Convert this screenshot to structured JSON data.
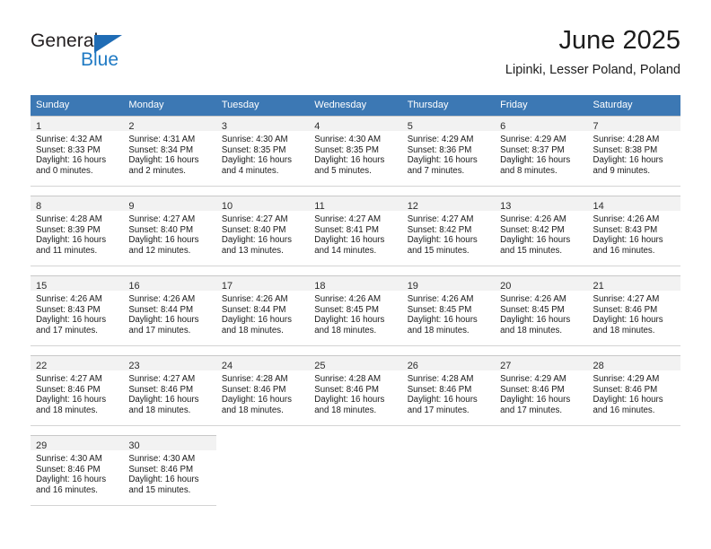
{
  "brand": {
    "name_top": "General",
    "name_bottom": "Blue",
    "triangle_color": "#1f6cb5",
    "text_color": "#231f20",
    "blue_color": "#1f7ac4"
  },
  "header": {
    "title": "June 2025",
    "subtitle": "Lipinki, Lesser Poland, Poland"
  },
  "colors": {
    "header_row_bg": "#3c78b4",
    "header_row_text": "#ffffff",
    "daynum_strip_bg": "#f2f2f2",
    "cell_border": "#d4d4d4",
    "body_text": "#1a1a1a"
  },
  "weekday_headers": [
    "Sunday",
    "Monday",
    "Tuesday",
    "Wednesday",
    "Thursday",
    "Friday",
    "Saturday"
  ],
  "weeks": [
    [
      {
        "day": "1",
        "sunrise": "Sunrise: 4:32 AM",
        "sunset": "Sunset: 8:33 PM",
        "daylight1": "Daylight: 16 hours",
        "daylight2": "and 0 minutes."
      },
      {
        "day": "2",
        "sunrise": "Sunrise: 4:31 AM",
        "sunset": "Sunset: 8:34 PM",
        "daylight1": "Daylight: 16 hours",
        "daylight2": "and 2 minutes."
      },
      {
        "day": "3",
        "sunrise": "Sunrise: 4:30 AM",
        "sunset": "Sunset: 8:35 PM",
        "daylight1": "Daylight: 16 hours",
        "daylight2": "and 4 minutes."
      },
      {
        "day": "4",
        "sunrise": "Sunrise: 4:30 AM",
        "sunset": "Sunset: 8:35 PM",
        "daylight1": "Daylight: 16 hours",
        "daylight2": "and 5 minutes."
      },
      {
        "day": "5",
        "sunrise": "Sunrise: 4:29 AM",
        "sunset": "Sunset: 8:36 PM",
        "daylight1": "Daylight: 16 hours",
        "daylight2": "and 7 minutes."
      },
      {
        "day": "6",
        "sunrise": "Sunrise: 4:29 AM",
        "sunset": "Sunset: 8:37 PM",
        "daylight1": "Daylight: 16 hours",
        "daylight2": "and 8 minutes."
      },
      {
        "day": "7",
        "sunrise": "Sunrise: 4:28 AM",
        "sunset": "Sunset: 8:38 PM",
        "daylight1": "Daylight: 16 hours",
        "daylight2": "and 9 minutes."
      }
    ],
    [
      {
        "day": "8",
        "sunrise": "Sunrise: 4:28 AM",
        "sunset": "Sunset: 8:39 PM",
        "daylight1": "Daylight: 16 hours",
        "daylight2": "and 11 minutes."
      },
      {
        "day": "9",
        "sunrise": "Sunrise: 4:27 AM",
        "sunset": "Sunset: 8:40 PM",
        "daylight1": "Daylight: 16 hours",
        "daylight2": "and 12 minutes."
      },
      {
        "day": "10",
        "sunrise": "Sunrise: 4:27 AM",
        "sunset": "Sunset: 8:40 PM",
        "daylight1": "Daylight: 16 hours",
        "daylight2": "and 13 minutes."
      },
      {
        "day": "11",
        "sunrise": "Sunrise: 4:27 AM",
        "sunset": "Sunset: 8:41 PM",
        "daylight1": "Daylight: 16 hours",
        "daylight2": "and 14 minutes."
      },
      {
        "day": "12",
        "sunrise": "Sunrise: 4:27 AM",
        "sunset": "Sunset: 8:42 PM",
        "daylight1": "Daylight: 16 hours",
        "daylight2": "and 15 minutes."
      },
      {
        "day": "13",
        "sunrise": "Sunrise: 4:26 AM",
        "sunset": "Sunset: 8:42 PM",
        "daylight1": "Daylight: 16 hours",
        "daylight2": "and 15 minutes."
      },
      {
        "day": "14",
        "sunrise": "Sunrise: 4:26 AM",
        "sunset": "Sunset: 8:43 PM",
        "daylight1": "Daylight: 16 hours",
        "daylight2": "and 16 minutes."
      }
    ],
    [
      {
        "day": "15",
        "sunrise": "Sunrise: 4:26 AM",
        "sunset": "Sunset: 8:43 PM",
        "daylight1": "Daylight: 16 hours",
        "daylight2": "and 17 minutes."
      },
      {
        "day": "16",
        "sunrise": "Sunrise: 4:26 AM",
        "sunset": "Sunset: 8:44 PM",
        "daylight1": "Daylight: 16 hours",
        "daylight2": "and 17 minutes."
      },
      {
        "day": "17",
        "sunrise": "Sunrise: 4:26 AM",
        "sunset": "Sunset: 8:44 PM",
        "daylight1": "Daylight: 16 hours",
        "daylight2": "and 18 minutes."
      },
      {
        "day": "18",
        "sunrise": "Sunrise: 4:26 AM",
        "sunset": "Sunset: 8:45 PM",
        "daylight1": "Daylight: 16 hours",
        "daylight2": "and 18 minutes."
      },
      {
        "day": "19",
        "sunrise": "Sunrise: 4:26 AM",
        "sunset": "Sunset: 8:45 PM",
        "daylight1": "Daylight: 16 hours",
        "daylight2": "and 18 minutes."
      },
      {
        "day": "20",
        "sunrise": "Sunrise: 4:26 AM",
        "sunset": "Sunset: 8:45 PM",
        "daylight1": "Daylight: 16 hours",
        "daylight2": "and 18 minutes."
      },
      {
        "day": "21",
        "sunrise": "Sunrise: 4:27 AM",
        "sunset": "Sunset: 8:46 PM",
        "daylight1": "Daylight: 16 hours",
        "daylight2": "and 18 minutes."
      }
    ],
    [
      {
        "day": "22",
        "sunrise": "Sunrise: 4:27 AM",
        "sunset": "Sunset: 8:46 PM",
        "daylight1": "Daylight: 16 hours",
        "daylight2": "and 18 minutes."
      },
      {
        "day": "23",
        "sunrise": "Sunrise: 4:27 AM",
        "sunset": "Sunset: 8:46 PM",
        "daylight1": "Daylight: 16 hours",
        "daylight2": "and 18 minutes."
      },
      {
        "day": "24",
        "sunrise": "Sunrise: 4:28 AM",
        "sunset": "Sunset: 8:46 PM",
        "daylight1": "Daylight: 16 hours",
        "daylight2": "and 18 minutes."
      },
      {
        "day": "25",
        "sunrise": "Sunrise: 4:28 AM",
        "sunset": "Sunset: 8:46 PM",
        "daylight1": "Daylight: 16 hours",
        "daylight2": "and 18 minutes."
      },
      {
        "day": "26",
        "sunrise": "Sunrise: 4:28 AM",
        "sunset": "Sunset: 8:46 PM",
        "daylight1": "Daylight: 16 hours",
        "daylight2": "and 17 minutes."
      },
      {
        "day": "27",
        "sunrise": "Sunrise: 4:29 AM",
        "sunset": "Sunset: 8:46 PM",
        "daylight1": "Daylight: 16 hours",
        "daylight2": "and 17 minutes."
      },
      {
        "day": "28",
        "sunrise": "Sunrise: 4:29 AM",
        "sunset": "Sunset: 8:46 PM",
        "daylight1": "Daylight: 16 hours",
        "daylight2": "and 16 minutes."
      }
    ],
    [
      {
        "day": "29",
        "sunrise": "Sunrise: 4:30 AM",
        "sunset": "Sunset: 8:46 PM",
        "daylight1": "Daylight: 16 hours",
        "daylight2": "and 16 minutes."
      },
      {
        "day": "30",
        "sunrise": "Sunrise: 4:30 AM",
        "sunset": "Sunset: 8:46 PM",
        "daylight1": "Daylight: 16 hours",
        "daylight2": "and 15 minutes."
      },
      null,
      null,
      null,
      null,
      null
    ]
  ]
}
